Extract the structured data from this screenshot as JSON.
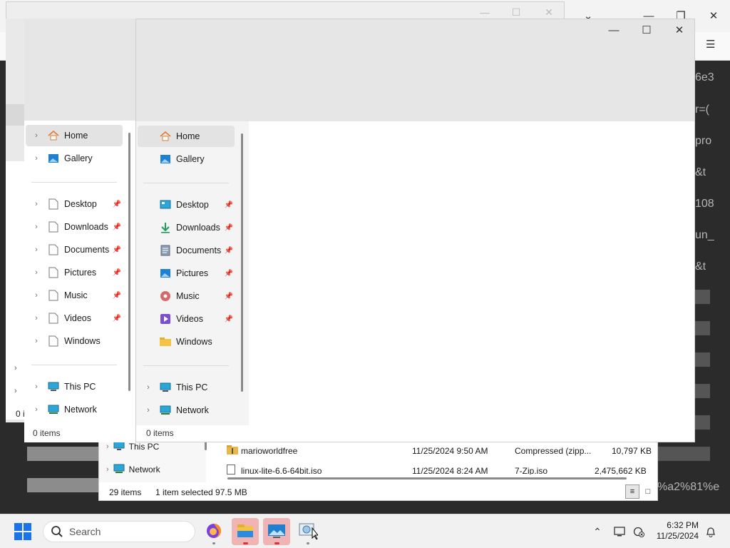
{
  "browser": {
    "right_fragments": [
      "6e3",
      "r=(",
      "pro",
      "&t",
      "108",
      "un_",
      "&t",
      "%a2%81%e"
    ]
  },
  "nav_items": [
    {
      "label": "Home",
      "icon": "home-icon",
      "chevron": true,
      "selected": true
    },
    {
      "label": "Gallery",
      "icon": "gallery-icon",
      "chevron": true
    },
    {
      "label": "Desktop",
      "icon": "desktop-icon",
      "pinned": true
    },
    {
      "label": "Downloads",
      "icon": "downloads-icon",
      "pinned": true
    },
    {
      "label": "Documents",
      "icon": "documents-icon",
      "pinned": true
    },
    {
      "label": "Pictures",
      "icon": "pictures-icon",
      "pinned": true
    },
    {
      "label": "Music",
      "icon": "music-icon",
      "pinned": true
    },
    {
      "label": "Videos",
      "icon": "videos-icon",
      "pinned": true
    },
    {
      "label": "Windows",
      "icon": "folder-icon"
    },
    {
      "label": "This PC",
      "icon": "this-pc-icon"
    },
    {
      "label": "Network",
      "icon": "network-icon"
    }
  ],
  "explorer_a": {
    "status": "0 items"
  },
  "explorer_b": {
    "status": "0 items"
  },
  "explorer_back": {
    "nav": [
      {
        "label": "This PC",
        "icon": "this-pc-icon"
      },
      {
        "label": "Network",
        "icon": "network-icon"
      }
    ],
    "files": [
      {
        "name": "marioworldfree",
        "date": "11/25/2024 9:50 AM",
        "type": "Compressed (zipp...",
        "size": "10,797 KB"
      },
      {
        "name": "linux-lite-6.6-64bit.iso",
        "date": "11/25/2024 8:24 AM",
        "type": "7-Zip.iso",
        "size": "2,475,662 KB"
      }
    ],
    "status_count": "29 items",
    "status_selected": "1 item selected  97.5 MB"
  },
  "left_fragment": "0 i",
  "taskbar": {
    "search_placeholder": "Search",
    "time": "6:32 PM",
    "date": "11/25/2024"
  },
  "colors": {
    "accent": "#1a73e8",
    "active_app": "#f0b4b4",
    "indicator": "#dd3333"
  }
}
